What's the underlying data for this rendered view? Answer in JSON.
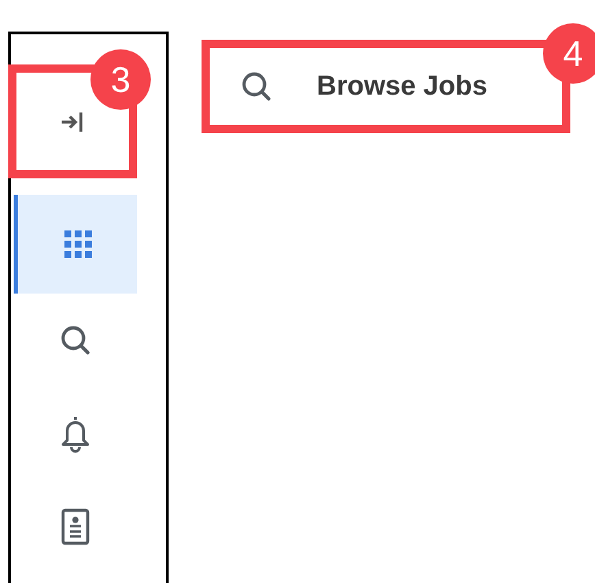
{
  "sidebar": {
    "collapse_button": {
      "annotation": "3"
    },
    "items": [
      {
        "kind": "apps",
        "selected": true
      },
      {
        "kind": "search",
        "selected": false
      },
      {
        "kind": "notifications",
        "selected": false
      },
      {
        "kind": "profile",
        "selected": false
      }
    ]
  },
  "search_bar": {
    "label": "Browse Jobs",
    "annotation": "4"
  }
}
